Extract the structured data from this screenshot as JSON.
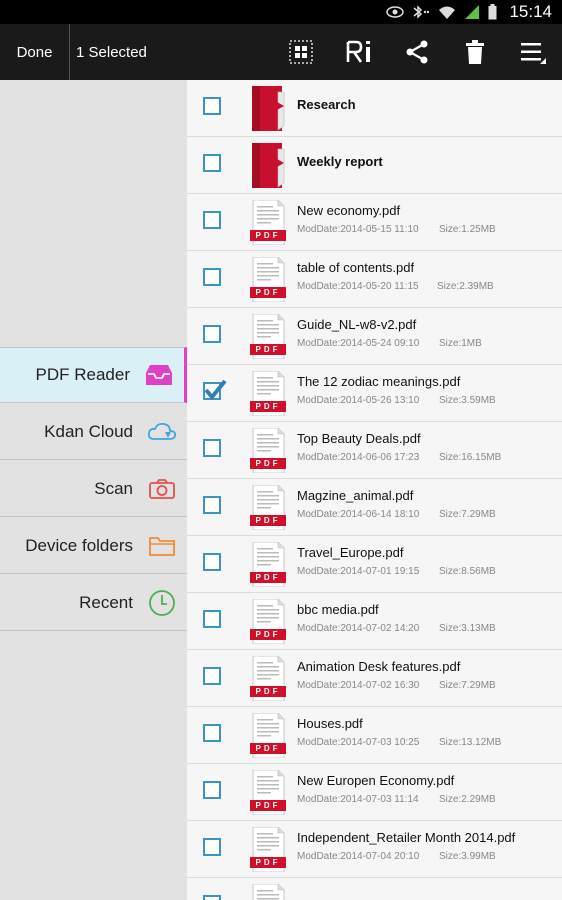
{
  "status": {
    "time": "15:14"
  },
  "actionbar": {
    "done": "Done",
    "selected": "1 Selected"
  },
  "sidebar": {
    "items": [
      {
        "label": "PDF Reader",
        "icon": "inbox-icon",
        "active": true
      },
      {
        "label": "Kdan Cloud",
        "icon": "cloud-icon",
        "active": false
      },
      {
        "label": "Scan",
        "icon": "camera-icon",
        "active": false
      },
      {
        "label": "Device folders",
        "icon": "folder-icon",
        "active": false
      },
      {
        "label": "Recent",
        "icon": "clock-icon",
        "active": false
      }
    ]
  },
  "files": [
    {
      "type": "folder",
      "name": "Research",
      "checked": false
    },
    {
      "type": "folder",
      "name": "Weekly report",
      "checked": false
    },
    {
      "type": "pdf",
      "name": "New economy.pdf",
      "mod": "ModDate:2014-05-15 11:10",
      "size": "Size:1.25MB",
      "checked": false
    },
    {
      "type": "pdf",
      "name": "table of contents.pdf",
      "mod": "ModDate:2014-05-20 11:15",
      "size": "Size:2.39MB",
      "checked": false
    },
    {
      "type": "pdf",
      "name": "Guide_NL-w8-v2.pdf",
      "mod": "ModDate:2014-05-24 09:10",
      "size": "Size:1MB",
      "checked": false
    },
    {
      "type": "pdf",
      "name": "The 12 zodiac meanings.pdf",
      "mod": "ModDate:2014-05-26 13:10",
      "size": "Size:3.59MB",
      "checked": true
    },
    {
      "type": "pdf",
      "name": "Top Beauty Deals.pdf",
      "mod": "ModDate:2014-06-06 17:23",
      "size": "Size:16.15MB",
      "checked": false
    },
    {
      "type": "pdf",
      "name": "Magzine_animal.pdf",
      "mod": "ModDate:2014-06-14 18:10",
      "size": "Size:7.29MB",
      "checked": false
    },
    {
      "type": "pdf",
      "name": "Travel_Europe.pdf",
      "mod": "ModDate:2014-07-01 19:15",
      "size": "Size:8.56MB",
      "checked": false
    },
    {
      "type": "pdf",
      "name": "bbc media.pdf",
      "mod": "ModDate:2014-07-02 14:20",
      "size": "Size:3.13MB",
      "checked": false
    },
    {
      "type": "pdf",
      "name": "Animation Desk features.pdf",
      "mod": "ModDate:2014-07-02 16:30",
      "size": "Size:7.29MB",
      "checked": false
    },
    {
      "type": "pdf",
      "name": "Houses.pdf",
      "mod": "ModDate:2014-07-03 10:25",
      "size": "Size:13.12MB",
      "checked": false
    },
    {
      "type": "pdf",
      "name": "New Europen Economy.pdf",
      "mod": "ModDate:2014-07-03 11:14",
      "size": "Size:2.29MB",
      "checked": false
    },
    {
      "type": "pdf",
      "name": "Independent_Retailer Month 2014.pdf",
      "mod": "ModDate:2014-07-04 20:10",
      "size": "Size:3.99MB",
      "checked": false
    },
    {
      "type": "pdf",
      "name": "",
      "mod": "",
      "size": "",
      "checked": false
    }
  ],
  "pdf_badge": "PDF",
  "colors": {
    "accent": "#3b93c4",
    "active_nav": "#d9f0f6",
    "active_bar": "#e040c8",
    "pdf_red": "#d0102a"
  }
}
